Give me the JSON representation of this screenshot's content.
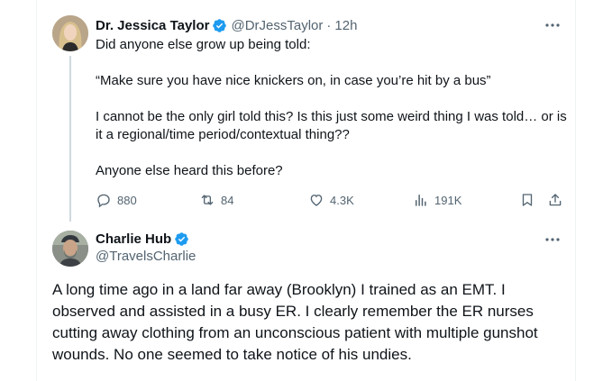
{
  "tweet1": {
    "name": "Dr. Jessica Taylor",
    "handle": "@DrJessTaylor",
    "separator": "·",
    "time": "12h",
    "paragraphs": [
      "Did anyone else grow up being told:",
      "“Make sure you have nice knickers on, in case you’re hit by a bus”",
      "I cannot be the only girl told this? Is this just some weird thing I was told… or is it a regional/time period/contextual thing??",
      "Anyone else heard this before?"
    ],
    "stats": {
      "replies": "880",
      "reposts": "84",
      "likes": "4.3K",
      "views": "191K"
    }
  },
  "tweet2": {
    "name": "Charlie Hub",
    "handle": "@TravelsCharlie",
    "text": "A long time ago in a land far away (Brooklyn) I trained as an EMT.  I observed and assisted in a busy ER.  I clearly remember the ER nurses cutting away clothing from an unconscious patient with multiple gunshot wounds.  No one seemed to take notice of his undies."
  },
  "colors": {
    "verified": "#1d9bf0",
    "secondary_text": "#536471",
    "primary_text": "#0f1419",
    "thread_line": "#cfd9de"
  },
  "icons": [
    "verified-badge-icon",
    "more-icon",
    "reply-icon",
    "repost-icon",
    "like-icon",
    "views-icon",
    "bookmark-icon",
    "share-icon"
  ]
}
